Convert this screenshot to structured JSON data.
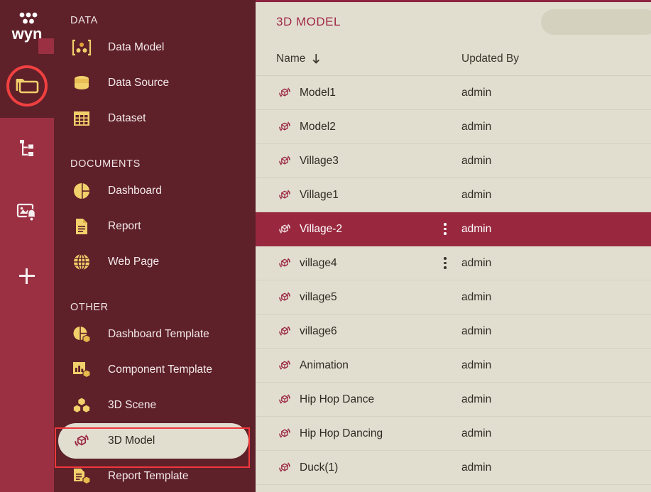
{
  "brand": {
    "logo_text": "wyn"
  },
  "rail": {
    "items": [
      {
        "name": "documents-folder",
        "icon": "folder-icon",
        "active": true,
        "annotated": true
      },
      {
        "name": "organization",
        "icon": "hierarchy-icon",
        "active": false,
        "annotated": false
      },
      {
        "name": "monitoring",
        "icon": "image-alert-icon",
        "active": false,
        "annotated": false
      },
      {
        "name": "create-new",
        "icon": "plus-icon",
        "active": false,
        "annotated": false
      }
    ]
  },
  "sidebar": {
    "sections": [
      {
        "title": "DATA",
        "items": [
          {
            "label": "Data Model",
            "icon": "data-model-icon",
            "selected": false
          },
          {
            "label": "Data Source",
            "icon": "database-icon",
            "selected": false
          },
          {
            "label": "Dataset",
            "icon": "table-grid-icon",
            "selected": false
          }
        ]
      },
      {
        "title": "DOCUMENTS",
        "items": [
          {
            "label": "Dashboard",
            "icon": "pie-chart-icon",
            "selected": false
          },
          {
            "label": "Report",
            "icon": "document-icon",
            "selected": false
          },
          {
            "label": "Web Page",
            "icon": "globe-icon",
            "selected": false
          }
        ]
      },
      {
        "title": "OTHER",
        "items": [
          {
            "label": "Dashboard Template",
            "icon": "pie-template-icon",
            "selected": false
          },
          {
            "label": "Component Template",
            "icon": "bar-template-icon",
            "selected": false
          },
          {
            "label": "3D Scene",
            "icon": "cubes-icon",
            "selected": false
          },
          {
            "label": "3D Model",
            "icon": "model-3d-icon",
            "selected": true
          },
          {
            "label": "Report Template",
            "icon": "report-template-icon",
            "selected": false
          }
        ]
      }
    ]
  },
  "main": {
    "title": "3D MODEL",
    "search": {
      "placeholder": ""
    },
    "columns": {
      "name": "Name",
      "sort_icon": "sort-descending-icon",
      "updated_by": "Updated By"
    },
    "rows": [
      {
        "name": "Model1",
        "updated_by": "admin",
        "icon": "model-3d-icon",
        "selected": false,
        "kebab": false
      },
      {
        "name": "Model2",
        "updated_by": "admin",
        "icon": "model-3d-icon",
        "selected": false,
        "kebab": false
      },
      {
        "name": "Village3",
        "updated_by": "admin",
        "icon": "model-3d-icon",
        "selected": false,
        "kebab": false
      },
      {
        "name": "Village1",
        "updated_by": "admin",
        "icon": "model-3d-icon",
        "selected": false,
        "kebab": false
      },
      {
        "name": "Village-2",
        "updated_by": "admin",
        "icon": "model-3d-icon",
        "selected": true,
        "kebab": true
      },
      {
        "name": "village4",
        "updated_by": "admin",
        "icon": "model-3d-icon",
        "selected": false,
        "kebab": true
      },
      {
        "name": "village5",
        "updated_by": "admin",
        "icon": "model-3d-icon",
        "selected": false,
        "kebab": false
      },
      {
        "name": "village6",
        "updated_by": "admin",
        "icon": "model-3d-icon",
        "selected": false,
        "kebab": false
      },
      {
        "name": "Animation",
        "updated_by": "admin",
        "icon": "model-3d-icon",
        "selected": false,
        "kebab": false
      },
      {
        "name": "Hip Hop Dance",
        "updated_by": "admin",
        "icon": "model-3d-icon",
        "selected": false,
        "kebab": false
      },
      {
        "name": "Hip Hop Dancing",
        "updated_by": "admin",
        "icon": "model-3d-icon",
        "selected": false,
        "kebab": false
      },
      {
        "name": "Duck(1)",
        "updated_by": "admin",
        "icon": "model-3d-icon",
        "selected": false,
        "kebab": false
      }
    ]
  },
  "colors": {
    "sidebar_bg": "#5E2029",
    "rail_bg": "#9B3043",
    "content_bg": "#E1DED0",
    "accent_yellow": "#F2D06B",
    "selected_row_bg": "#99283F",
    "annotation_red": "#F0383C",
    "title_red": "#A02A46"
  }
}
